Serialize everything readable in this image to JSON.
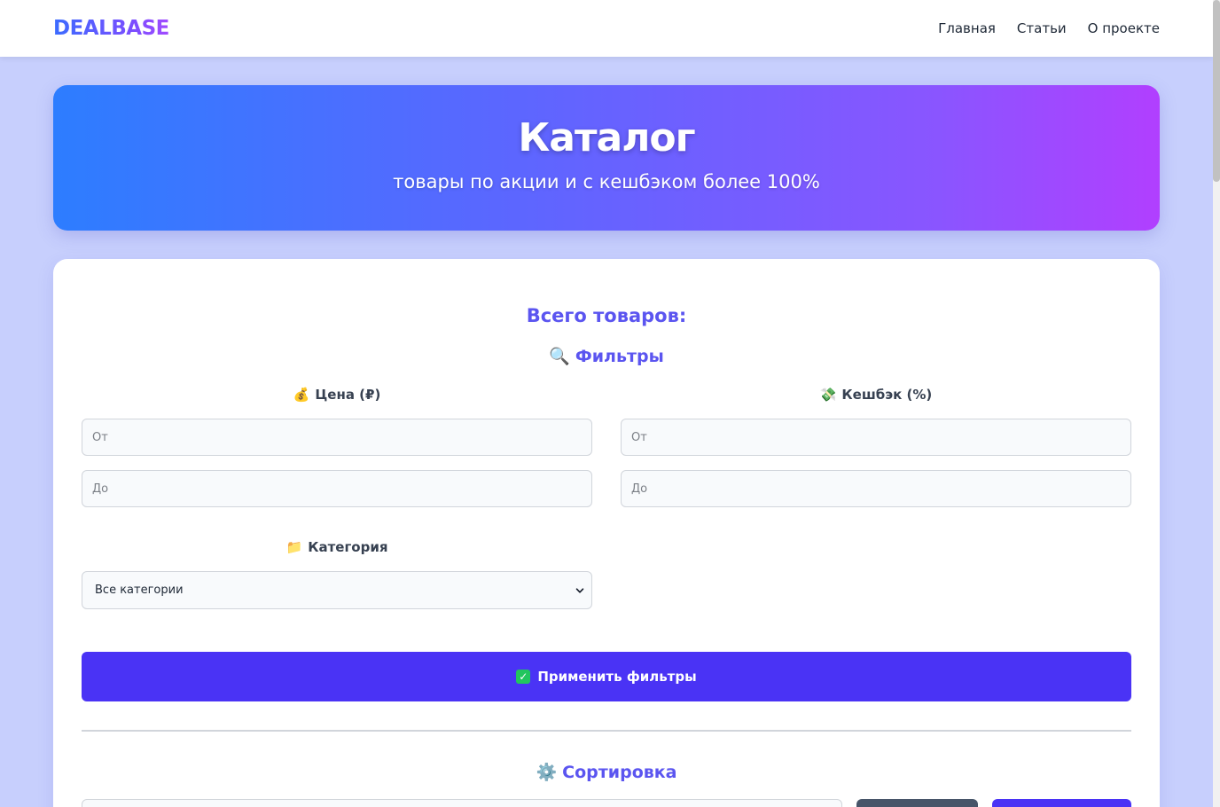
{
  "header": {
    "logo": "DEALBASE",
    "nav": [
      "Главная",
      "Статьи",
      "О проекте"
    ]
  },
  "hero": {
    "title": "Каталог",
    "subtitle": "товары по акции и с кешбэком более 100%"
  },
  "catalog": {
    "total_label": "Всего товаров:",
    "filters_title": "Фильтры",
    "filters_icon": "magnifier-icon",
    "price": {
      "icon": "money-bag-icon",
      "label": "Цена (₽)",
      "from_placeholder": "От",
      "to_placeholder": "До"
    },
    "cashback": {
      "icon": "money-wings-icon",
      "label": "Кешбэк (%)",
      "from_placeholder": "От",
      "to_placeholder": "До"
    },
    "category": {
      "icon": "folder-icon",
      "label": "Категория",
      "selected": "Все категории"
    },
    "apply_button": "Применить фильтры",
    "apply_icon": "check-box-icon",
    "sort_title": "Сортировка",
    "sort_icon": "gear-icon"
  },
  "colors": {
    "accent": "#5b55f0",
    "button": "#4a33f5",
    "page_bg": "#c7cffd"
  }
}
